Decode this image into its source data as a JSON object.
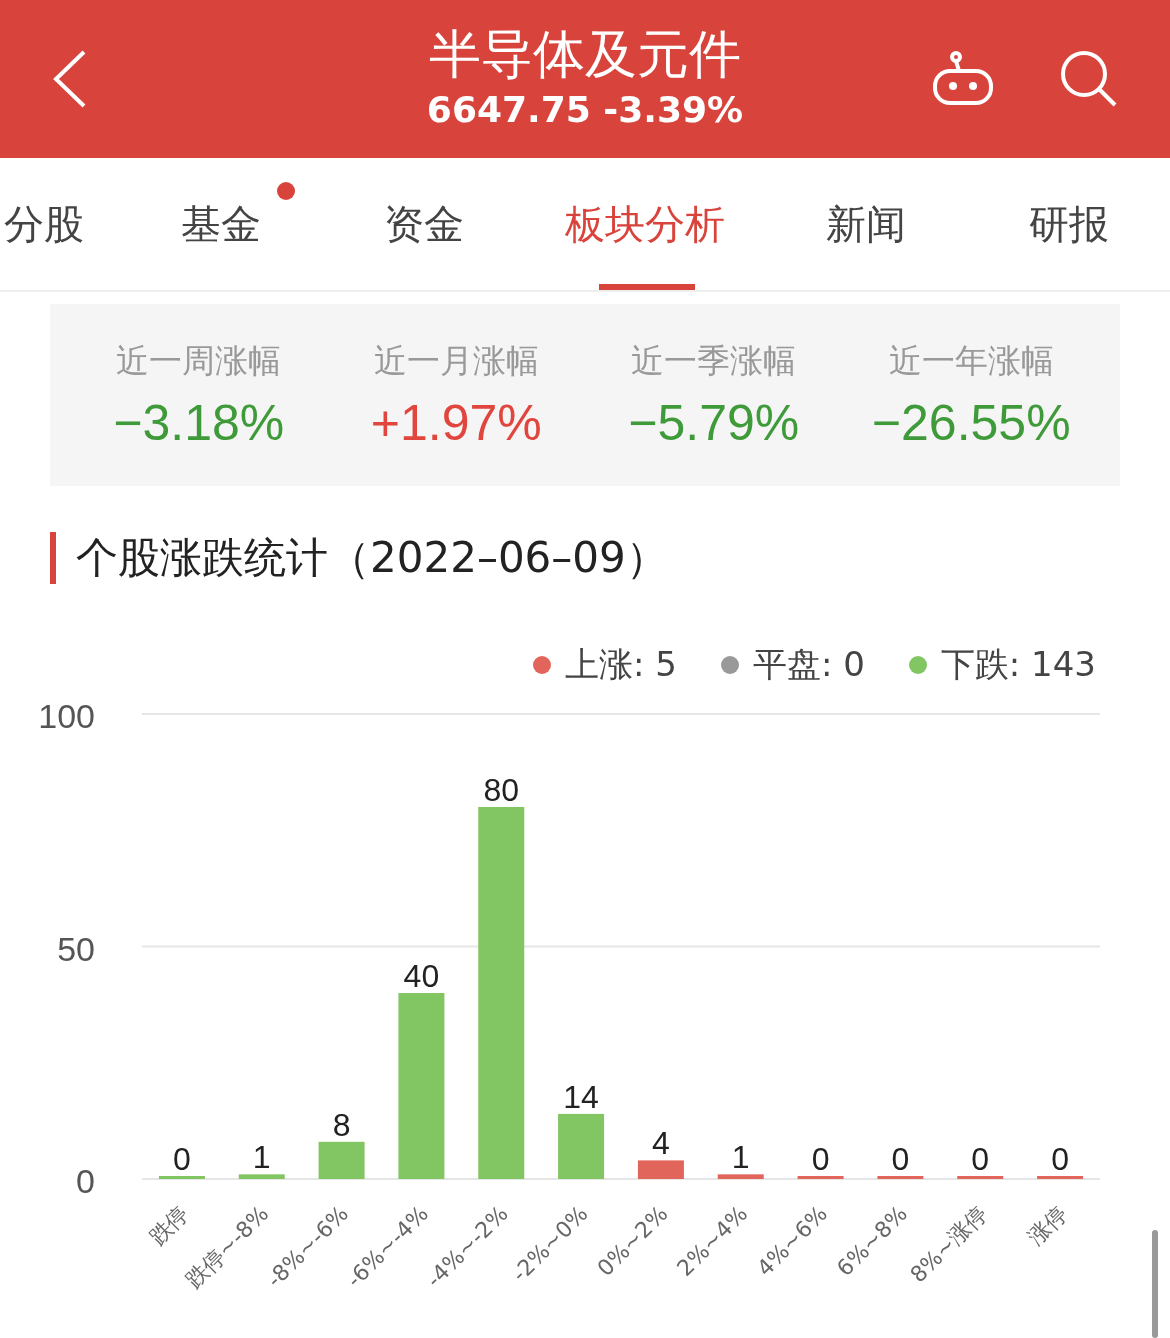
{
  "header": {
    "title": "半导体及元件",
    "quote": "6647.75 -3.39%"
  },
  "tabs": [
    {
      "label": "分股",
      "selected": false,
      "badge": false
    },
    {
      "label": "基金",
      "selected": false,
      "badge": true
    },
    {
      "label": "资金",
      "selected": false,
      "badge": false
    },
    {
      "label": "板块分析",
      "selected": true,
      "badge": false
    },
    {
      "label": "新闻",
      "selected": false,
      "badge": false
    },
    {
      "label": "研报",
      "selected": false,
      "badge": false
    }
  ],
  "stats": [
    {
      "label": "近一周涨幅",
      "value": "−3.18%",
      "color": "#3f9a3a"
    },
    {
      "label": "近一月涨幅",
      "value": "+1.97%",
      "color": "#e0463e"
    },
    {
      "label": "近一季涨幅",
      "value": "−5.79%",
      "color": "#3f9a3a"
    },
    {
      "label": "近一年涨幅",
      "value": "−26.55%",
      "color": "#3f9a3a"
    }
  ],
  "section_title": "个股涨跌统计（2022–06–09）",
  "legend": [
    {
      "label": "上涨: 5",
      "color": "#e2655b"
    },
    {
      "label": "平盘: 0",
      "color": "#999999"
    },
    {
      "label": "下跌: 143",
      "color": "#82c563"
    }
  ],
  "chart_data": {
    "type": "bar",
    "categories": [
      "跌停",
      "跌停~-8%",
      "-8%~-6%",
      "-6%~-4%",
      "-4%~-2%",
      "-2%~0%",
      "0%~2%",
      "2%~4%",
      "4%~6%",
      "6%~8%",
      "8%~涨停",
      "涨停"
    ],
    "series": [
      {
        "color": "#82c563",
        "values": [
          0,
          1,
          8,
          40,
          80,
          14,
          null,
          null,
          null,
          null,
          null,
          null
        ]
      },
      {
        "color": "#e2655b",
        "values": [
          null,
          null,
          null,
          null,
          null,
          null,
          4,
          1,
          0,
          0,
          0,
          0
        ]
      }
    ],
    "ylim": [
      0,
      100
    ],
    "yticks": [
      0,
      50,
      100
    ],
    "data_labels": true
  }
}
